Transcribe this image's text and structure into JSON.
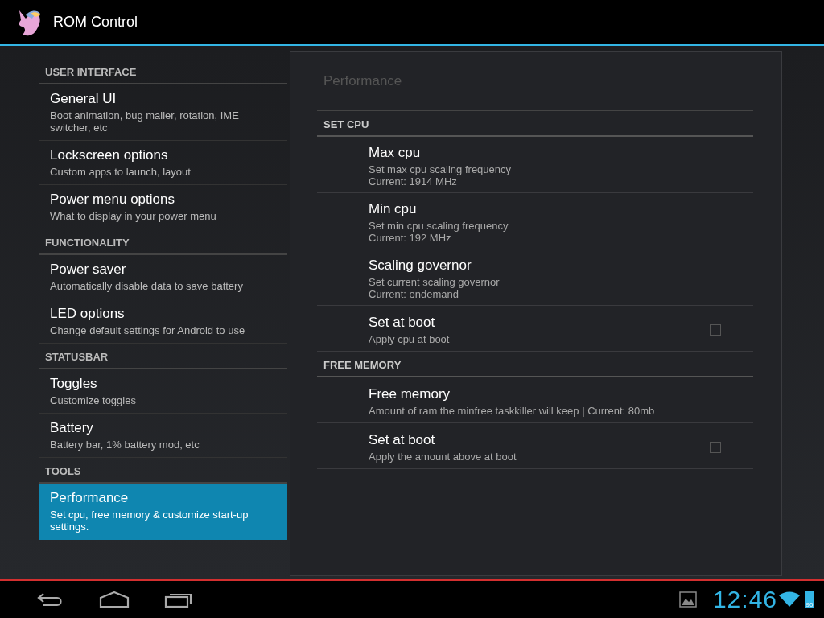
{
  "action_bar": {
    "title": "ROM Control"
  },
  "sidebar": {
    "sections": [
      {
        "header": "USER INTERFACE",
        "items": [
          {
            "title": "General UI",
            "summary": "Boot animation, bug mailer, rotation, IME switcher, etc",
            "selected": false
          },
          {
            "title": "Lockscreen options",
            "summary": "Custom apps to launch, layout",
            "selected": false
          },
          {
            "title": "Power menu options",
            "summary": "What to display in your power menu",
            "selected": false
          }
        ]
      },
      {
        "header": "FUNCTIONALITY",
        "items": [
          {
            "title": "Power saver",
            "summary": "Automatically disable data to save battery",
            "selected": false
          },
          {
            "title": "LED options",
            "summary": "Change default settings for Android to use",
            "selected": false
          }
        ]
      },
      {
        "header": "STATUSBAR",
        "items": [
          {
            "title": "Toggles",
            "summary": "Customize toggles",
            "selected": false
          },
          {
            "title": "Battery",
            "summary": "Battery bar, 1% battery mod, etc",
            "selected": false
          }
        ]
      },
      {
        "header": "TOOLS",
        "items": [
          {
            "title": "Performance",
            "summary": "Set cpu, free memory & customize start-up settings.",
            "selected": true
          }
        ]
      }
    ]
  },
  "panel": {
    "title": "Performance",
    "sections": [
      {
        "header": "SET CPU",
        "items": [
          {
            "kind": "preference",
            "title": "Max cpu",
            "summary": [
              "Set max cpu scaling frequency",
              "Current: 1914 MHz"
            ]
          },
          {
            "kind": "preference",
            "title": "Min cpu",
            "summary": [
              "Set min cpu scaling frequency",
              "Current: 192 MHz"
            ]
          },
          {
            "kind": "preference",
            "title": "Scaling governor",
            "summary": [
              "Set current scaling governor",
              "Current: ondemand"
            ]
          },
          {
            "kind": "checkbox",
            "title": "Set at boot",
            "summary": [
              "Apply cpu at boot"
            ],
            "checked": false
          }
        ]
      },
      {
        "header": "FREE MEMORY",
        "items": [
          {
            "kind": "preference",
            "title": "Free memory",
            "summary": [
              "Amount of ram the minfree taskkiller will keep | Current: 80mb"
            ]
          },
          {
            "kind": "checkbox",
            "title": "Set at boot",
            "summary": [
              "Apply the amount above at boot"
            ],
            "checked": false
          }
        ]
      }
    ]
  },
  "system_bar": {
    "clock": "12:46",
    "battery": "90"
  }
}
